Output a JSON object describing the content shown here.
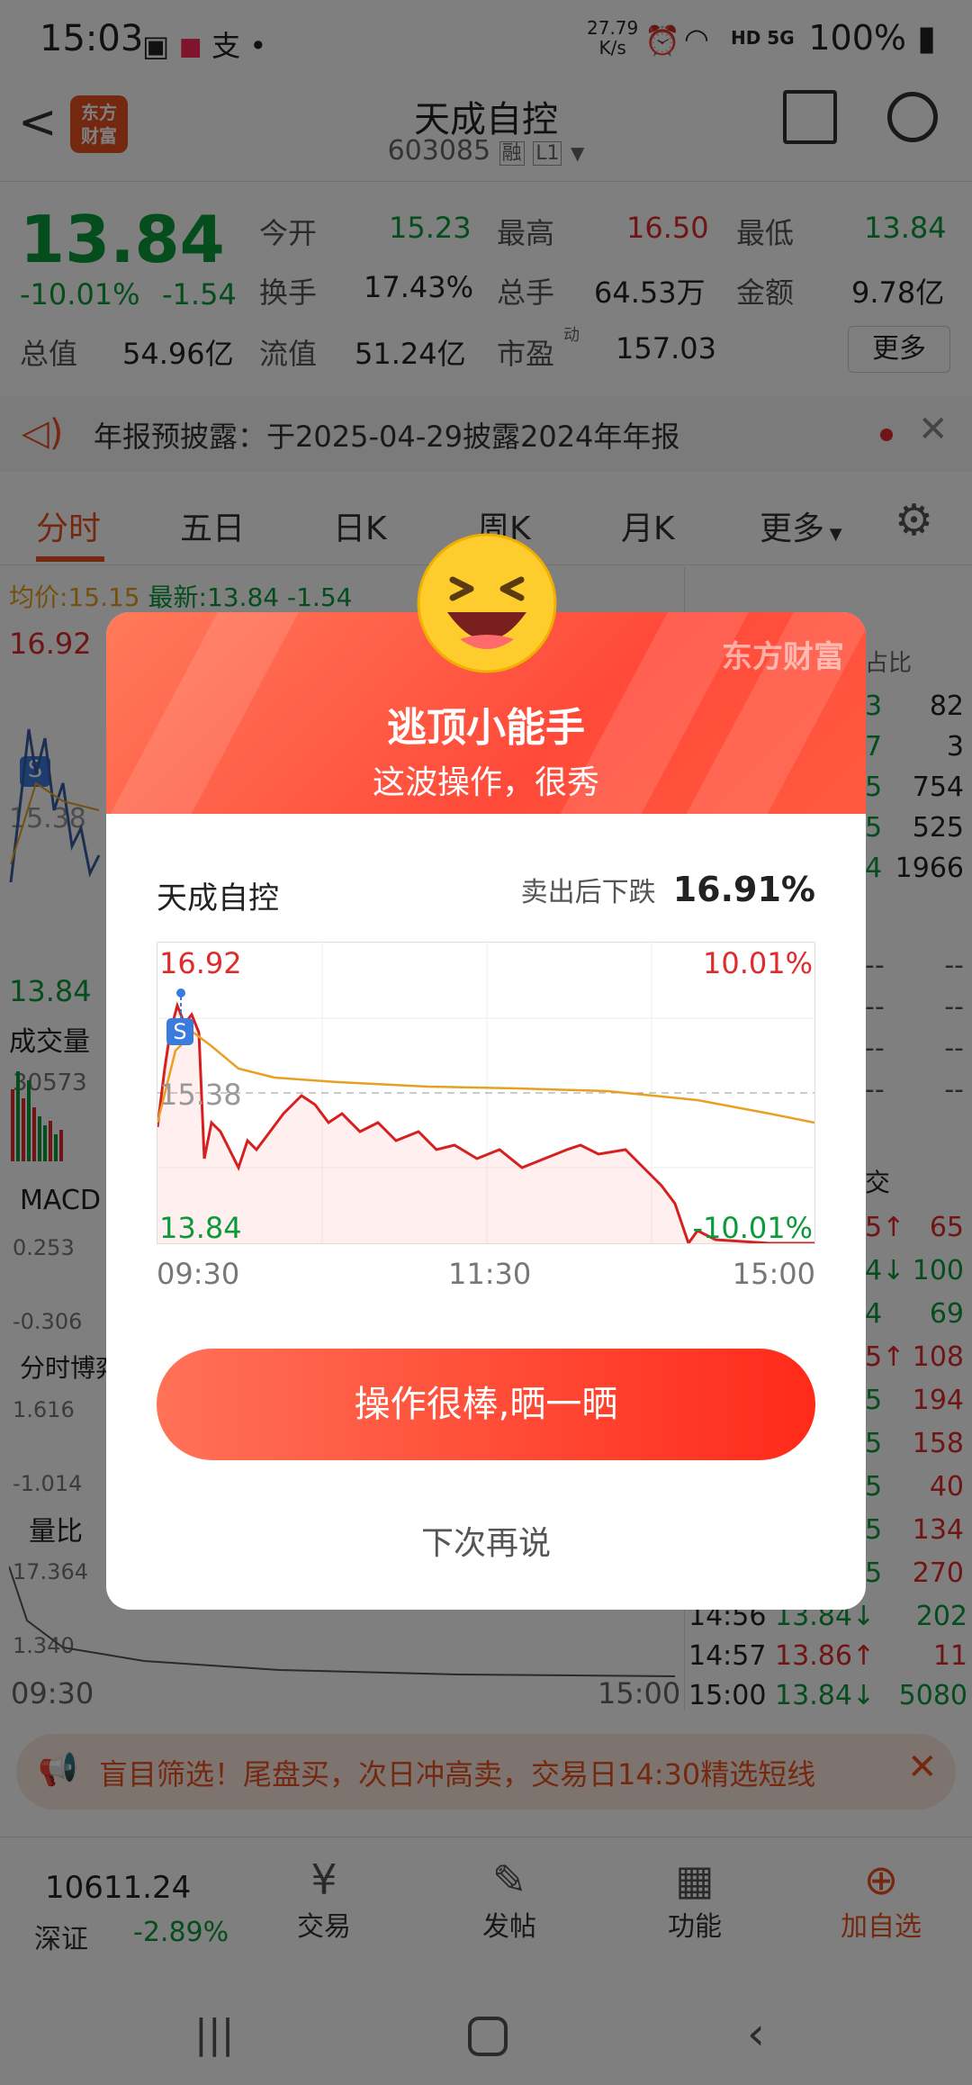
{
  "status_bar": {
    "time": "15:03",
    "notif_icons": [
      "image-icon",
      "shopping-bag-icon",
      "alipay-icon",
      "dot-icon"
    ],
    "net_speed": "27.79\nK/s",
    "signal": "HD 5G",
    "battery": "100%"
  },
  "header": {
    "back": "<",
    "logo_text_line1": "东方",
    "logo_text_line2": "财富",
    "title": "天成自控",
    "code": "603085",
    "tag1": "融",
    "tag2": "L1"
  },
  "quote": {
    "price": "13.84",
    "change_pct": "-10.01%",
    "change": "-1.54",
    "open_label": "今开",
    "open": "15.23",
    "high_label": "最高",
    "high": "16.50",
    "low_label": "最低",
    "low": "13.84",
    "turnover_label": "换手",
    "turnover": "17.43%",
    "volume_label": "总手",
    "volume": "64.53万",
    "amount_label": "金额",
    "amount": "9.78亿",
    "mcap_label": "总值",
    "mcap": "54.96亿",
    "float_label": "流值",
    "float": "51.24亿",
    "pe_label": "市盈",
    "pe_sup": "动",
    "pe": "157.03",
    "more": "更多"
  },
  "announcement": {
    "text": "年报预披露：于2025-04-29披露2024年年报"
  },
  "tabs": [
    "分时",
    "五日",
    "日K",
    "周K",
    "月K",
    "更多"
  ],
  "chart_labels": {
    "avg_label": "均价:",
    "avg": "15.15",
    "latest_label": "最新:",
    "latest": "13.84",
    "latest_chg": "-1.54",
    "top": "16.92",
    "mid": "15.38",
    "bottom": "13.84",
    "vol_label": "成交量",
    "vol_val": "30573",
    "macd_label": "MACD",
    "macd_top": "0.253",
    "macd_bot": "-0.306",
    "game_label": "分时博弈",
    "game_top": "1.616",
    "game_bot": "-1.014",
    "ratio_label": "量比",
    "ratio_top": "17.364",
    "ratio_bot": "1.340",
    "time_start": "09:30",
    "time_end": "15:00",
    "side_header": "占比",
    "side_vals": [
      "82",
      "3",
      "754",
      "525",
      "1966"
    ],
    "side_prefix": [
      "3",
      "7",
      "5",
      "5",
      "4"
    ],
    "dash": "--",
    "trade_header": "交",
    "trades_right": [
      {
        "p": "5↑",
        "v": "65"
      },
      {
        "p": "4↓",
        "v": "100"
      },
      {
        "p": "4",
        "v": "69"
      },
      {
        "p": "5↑",
        "v": "108"
      },
      {
        "p": "5",
        "v": "194"
      },
      {
        "p": "5",
        "v": "158"
      },
      {
        "p": "5",
        "v": "40"
      },
      {
        "p": "5",
        "v": "134"
      },
      {
        "p": "5",
        "v": "270"
      }
    ],
    "trades_full": [
      {
        "t": "14:56",
        "p": "13.84↓",
        "v": "202"
      },
      {
        "t": "14:57",
        "p": "13.86↑",
        "v": "11"
      },
      {
        "t": "15:00",
        "p": "13.84↓",
        "v": "5080"
      }
    ]
  },
  "promo": {
    "text": "盲目筛选！尾盘买，次日冲高卖，交易日14:30精选短线"
  },
  "bottom_nav": {
    "index_value": "10611.24",
    "index_name": "深证",
    "index_change": "-2.89%",
    "items": [
      "交易",
      "发帖",
      "功能",
      "加自选"
    ]
  },
  "modal": {
    "brand": "东方财富",
    "title": "逃顶小能手",
    "subtitle": "这波操作，很秀",
    "stock_name": "天成自控",
    "drop_label": "卖出后下跌",
    "drop_value": "16.91%",
    "chart_top_price": "16.92",
    "chart_top_pct": "10.01%",
    "chart_mid": "15.38",
    "chart_bot_price": "13.84",
    "chart_bot_pct": "-10.01%",
    "x_start": "09:30",
    "x_mid": "11:30",
    "x_end": "15:00",
    "sell_marker": "S",
    "cta": "操作很棒,晒一晒",
    "later": "下次再说"
  },
  "colors": {
    "up_red": "#e02b2b",
    "down_green": "#0a9a3a",
    "accent_orange": "#e8501f",
    "modal_red": "#ff4a3a"
  }
}
